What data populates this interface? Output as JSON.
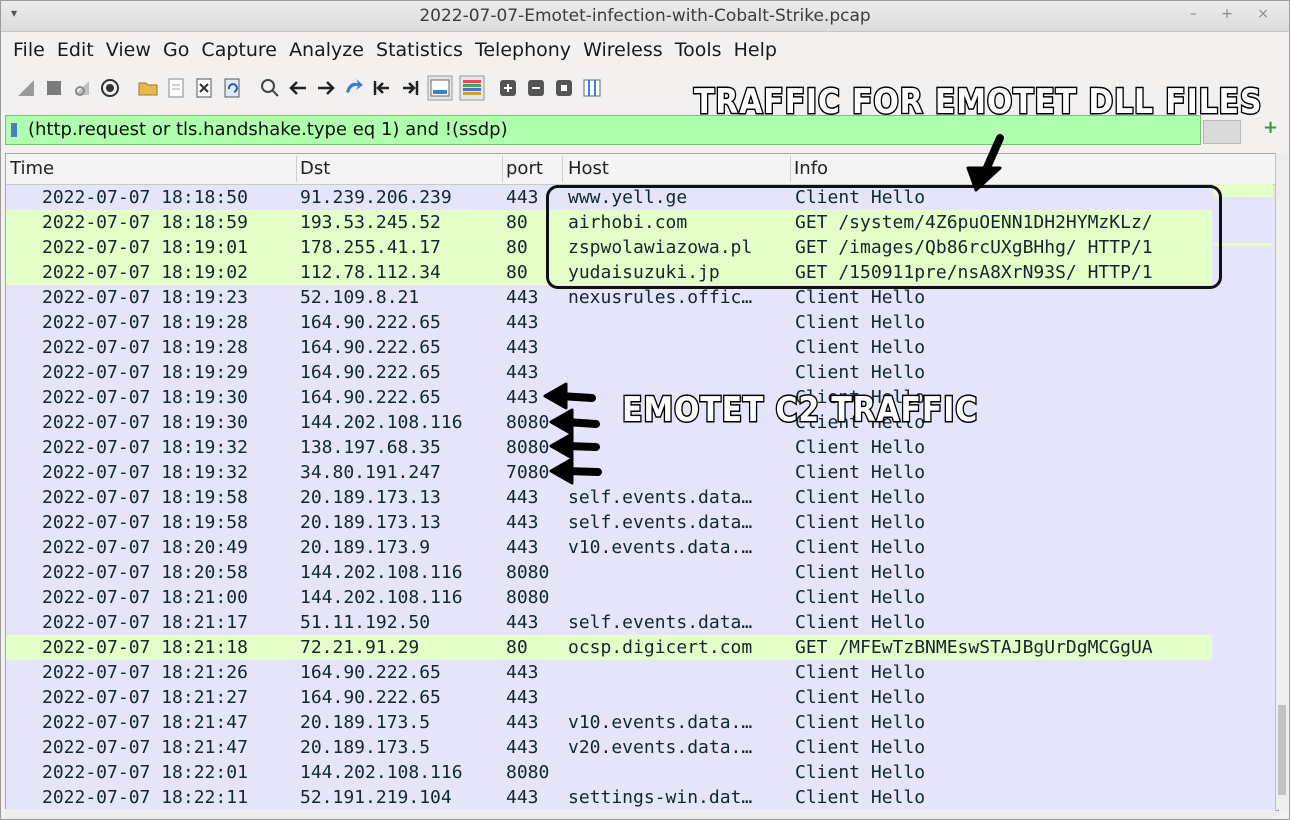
{
  "window": {
    "title": "2022-07-07-Emotet-infection-with-Cobalt-Strike.pcap",
    "controls": "– + ×"
  },
  "menu": [
    "File",
    "Edit",
    "View",
    "Go",
    "Capture",
    "Analyze",
    "Statistics",
    "Telephony",
    "Wireless",
    "Tools",
    "Help"
  ],
  "filter": {
    "text": "(http.request or tls.handshake.type eq 1) and !(ssdp)"
  },
  "columns": {
    "time": "Time",
    "dst": "Dst",
    "port": "port",
    "host": "Host",
    "info": "Info"
  },
  "rows": [
    {
      "time": "2022-07-07 18:18:50",
      "dst": "91.239.206.239",
      "port": "443",
      "host": "www.yell.ge",
      "info": "Client Hello",
      "type": "tls"
    },
    {
      "time": "2022-07-07 18:18:59",
      "dst": "193.53.245.52",
      "port": "80",
      "host": "airhobi.com",
      "info": "GET /system/4Z6puOENN1DH2HYMzKLz/",
      "type": "http"
    },
    {
      "time": "2022-07-07 18:19:01",
      "dst": "178.255.41.17",
      "port": "80",
      "host": "zspwolawiazowa.pl",
      "info": "GET /images/Qb86rcUXgBHhg/ HTTP/1",
      "type": "http"
    },
    {
      "time": "2022-07-07 18:19:02",
      "dst": "112.78.112.34",
      "port": "80",
      "host": "yudaisuzuki.jp",
      "info": "GET /150911pre/nsA8XrN93S/ HTTP/1",
      "type": "http"
    },
    {
      "time": "2022-07-07 18:19:23",
      "dst": "52.109.8.21",
      "port": "443",
      "host": "nexusrules.offic…",
      "info": "Client Hello",
      "type": "tls"
    },
    {
      "time": "2022-07-07 18:19:28",
      "dst": "164.90.222.65",
      "port": "443",
      "host": "",
      "info": "Client Hello",
      "type": "tls"
    },
    {
      "time": "2022-07-07 18:19:28",
      "dst": "164.90.222.65",
      "port": "443",
      "host": "",
      "info": "Client Hello",
      "type": "tls"
    },
    {
      "time": "2022-07-07 18:19:29",
      "dst": "164.90.222.65",
      "port": "443",
      "host": "",
      "info": "Client Hello",
      "type": "tls"
    },
    {
      "time": "2022-07-07 18:19:30",
      "dst": "164.90.222.65",
      "port": "443",
      "host": "",
      "info": "Client Hello",
      "type": "tls"
    },
    {
      "time": "2022-07-07 18:19:30",
      "dst": "144.202.108.116",
      "port": "8080",
      "host": "",
      "info": "Client Hello",
      "type": "tls"
    },
    {
      "time": "2022-07-07 18:19:32",
      "dst": "138.197.68.35",
      "port": "8080",
      "host": "",
      "info": "Client Hello",
      "type": "tls"
    },
    {
      "time": "2022-07-07 18:19:32",
      "dst": "34.80.191.247",
      "port": "7080",
      "host": "",
      "info": "Client Hello",
      "type": "tls"
    },
    {
      "time": "2022-07-07 18:19:58",
      "dst": "20.189.173.13",
      "port": "443",
      "host": "self.events.data…",
      "info": "Client Hello",
      "type": "tls"
    },
    {
      "time": "2022-07-07 18:19:58",
      "dst": "20.189.173.13",
      "port": "443",
      "host": "self.events.data…",
      "info": "Client Hello",
      "type": "tls"
    },
    {
      "time": "2022-07-07 18:20:49",
      "dst": "20.189.173.9",
      "port": "443",
      "host": "v10.events.data.…",
      "info": "Client Hello",
      "type": "tls"
    },
    {
      "time": "2022-07-07 18:20:58",
      "dst": "144.202.108.116",
      "port": "8080",
      "host": "",
      "info": "Client Hello",
      "type": "tls"
    },
    {
      "time": "2022-07-07 18:21:00",
      "dst": "144.202.108.116",
      "port": "8080",
      "host": "",
      "info": "Client Hello",
      "type": "tls"
    },
    {
      "time": "2022-07-07 18:21:17",
      "dst": "51.11.192.50",
      "port": "443",
      "host": "self.events.data…",
      "info": "Client Hello",
      "type": "tls"
    },
    {
      "time": "2022-07-07 18:21:18",
      "dst": "72.21.91.29",
      "port": "80",
      "host": "ocsp.digicert.com",
      "info": "GET /MFEwTzBNMEswSTAJBgUrDgMCGgUA",
      "type": "http"
    },
    {
      "time": "2022-07-07 18:21:26",
      "dst": "164.90.222.65",
      "port": "443",
      "host": "",
      "info": "Client Hello",
      "type": "tls"
    },
    {
      "time": "2022-07-07 18:21:27",
      "dst": "164.90.222.65",
      "port": "443",
      "host": "",
      "info": "Client Hello",
      "type": "tls"
    },
    {
      "time": "2022-07-07 18:21:47",
      "dst": "20.189.173.5",
      "port": "443",
      "host": "v10.events.data.…",
      "info": "Client Hello",
      "type": "tls"
    },
    {
      "time": "2022-07-07 18:21:47",
      "dst": "20.189.173.5",
      "port": "443",
      "host": "v20.events.data.…",
      "info": "Client Hello",
      "type": "tls"
    },
    {
      "time": "2022-07-07 18:22:01",
      "dst": "144.202.108.116",
      "port": "8080",
      "host": "",
      "info": "Client Hello",
      "type": "tls"
    },
    {
      "time": "2022-07-07 18:22:11",
      "dst": "52.191.219.104",
      "port": "443",
      "host": "settings-win.dat…",
      "info": "Client Hello",
      "type": "tls"
    }
  ],
  "annotations": {
    "dll": "TRAFFIC FOR EMOTET DLL FILES",
    "c2": "EMOTET C2 TRAFFIC"
  },
  "colors": {
    "http_row": "#e4ffc7",
    "tls_row": "#e4e5fb",
    "filter_bg": "#afffaf"
  }
}
